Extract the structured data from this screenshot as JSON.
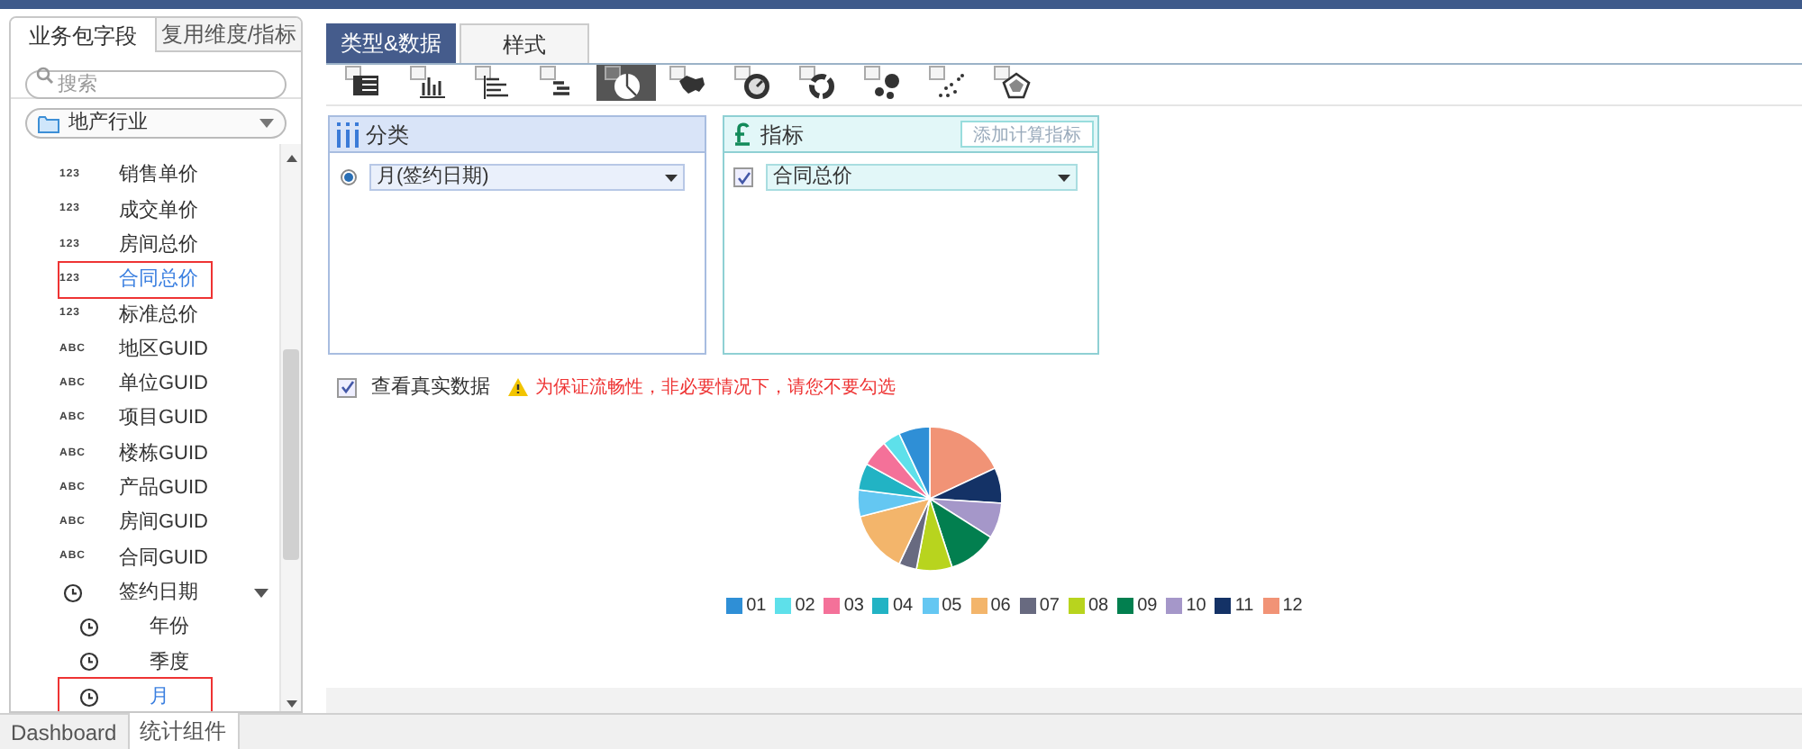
{
  "left_panel": {
    "tabs": [
      {
        "label": "业务包字段",
        "selected": true
      },
      {
        "label": "复用维度/指标",
        "selected": false
      }
    ],
    "search": {
      "placeholder": "搜索"
    },
    "package_select": {
      "value": "地产行业"
    },
    "fields": [
      {
        "kind": "number",
        "type_label": "123",
        "label": "销售单价",
        "selected": false,
        "marked": false
      },
      {
        "kind": "number",
        "type_label": "123",
        "label": "成交单价",
        "selected": false,
        "marked": false
      },
      {
        "kind": "number",
        "type_label": "123",
        "label": "房间总价",
        "selected": false,
        "marked": false
      },
      {
        "kind": "number",
        "type_label": "123",
        "label": "合同总价",
        "selected": true,
        "marked": true
      },
      {
        "kind": "number",
        "type_label": "123",
        "label": "标准总价",
        "selected": false,
        "marked": false
      },
      {
        "kind": "text",
        "type_label": "ABC",
        "label": "地区GUID",
        "selected": false,
        "marked": false
      },
      {
        "kind": "text",
        "type_label": "ABC",
        "label": "单位GUID",
        "selected": false,
        "marked": false
      },
      {
        "kind": "text",
        "type_label": "ABC",
        "label": "项目GUID",
        "selected": false,
        "marked": false
      },
      {
        "kind": "text",
        "type_label": "ABC",
        "label": "楼栋GUID",
        "selected": false,
        "marked": false
      },
      {
        "kind": "text",
        "type_label": "ABC",
        "label": "产品GUID",
        "selected": false,
        "marked": false
      },
      {
        "kind": "text",
        "type_label": "ABC",
        "label": "房间GUID",
        "selected": false,
        "marked": false
      },
      {
        "kind": "text",
        "type_label": "ABC",
        "label": "合同GUID",
        "selected": false,
        "marked": false
      },
      {
        "kind": "date",
        "label": "签约日期",
        "selected": false,
        "marked": false,
        "expanded": true,
        "children": [
          {
            "kind": "date",
            "label": "年份",
            "selected": false,
            "marked": false
          },
          {
            "kind": "date",
            "label": "季度",
            "selected": false,
            "marked": false
          },
          {
            "kind": "date",
            "label": "月",
            "selected": true,
            "marked": true
          }
        ]
      }
    ]
  },
  "editor_tabs": [
    {
      "label": "类型&数据",
      "selected": true
    },
    {
      "label": "样式",
      "selected": false
    }
  ],
  "chart_types": [
    {
      "kind": "table",
      "selected": false
    },
    {
      "kind": "column",
      "selected": false
    },
    {
      "kind": "bar",
      "selected": false
    },
    {
      "kind": "stacked",
      "selected": false
    },
    {
      "kind": "pie",
      "selected": true
    },
    {
      "kind": "map",
      "selected": false
    },
    {
      "kind": "gauge",
      "selected": false
    },
    {
      "kind": "donut",
      "selected": false
    },
    {
      "kind": "bubble",
      "selected": false
    },
    {
      "kind": "scatter",
      "selected": false
    },
    {
      "kind": "radar",
      "selected": false
    }
  ],
  "category_panel": {
    "title": "分类",
    "item": {
      "value": "月(签约日期)",
      "selected": true
    }
  },
  "metric_panel": {
    "title": "指标",
    "button": "添加计算指标",
    "item": {
      "value": "合同总价",
      "checked": true
    }
  },
  "real_data": {
    "label": "查看真实数据",
    "checked": true,
    "warning": "为保证流畅性，非必要情况下，请您不要勾选"
  },
  "pie_legend": [
    {
      "label": "01",
      "color": "#2f8fd6"
    },
    {
      "label": "02",
      "color": "#5ee0ea"
    },
    {
      "label": "03",
      "color": "#f47199"
    },
    {
      "label": "04",
      "color": "#22b3c4"
    },
    {
      "label": "05",
      "color": "#64c7f2"
    },
    {
      "label": "06",
      "color": "#f3b56b"
    },
    {
      "label": "07",
      "color": "#686a80"
    },
    {
      "label": "08",
      "color": "#b8d41e"
    },
    {
      "label": "09",
      "color": "#027f4f"
    },
    {
      "label": "10",
      "color": "#a597c9"
    },
    {
      "label": "11",
      "color": "#143266"
    },
    {
      "label": "12",
      "color": "#f19376"
    }
  ],
  "bottom_tabs": [
    {
      "label": "Dashboard",
      "selected": false
    },
    {
      "label": "统计组件",
      "selected": true
    }
  ]
}
